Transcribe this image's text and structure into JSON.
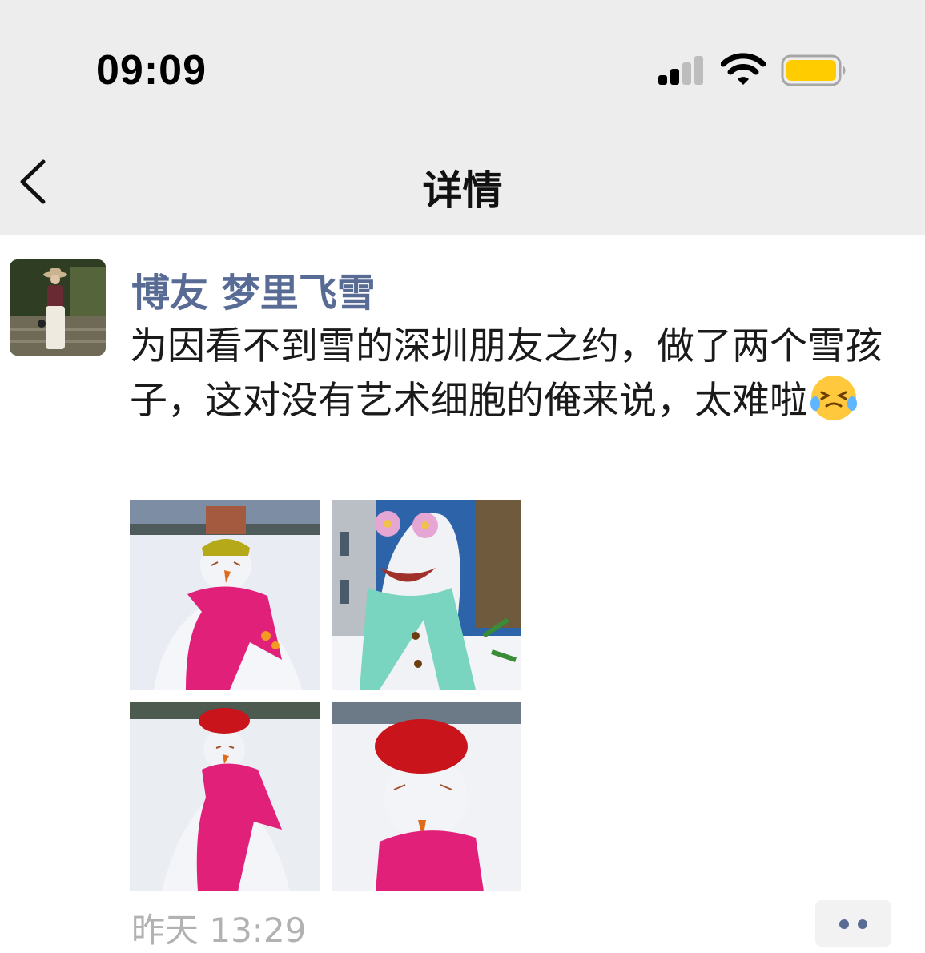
{
  "status_bar": {
    "time": "09:09"
  },
  "nav": {
    "title": "详情"
  },
  "post": {
    "author": "博友 梦里飞雪",
    "content": "为因看不到雪的深圳朋友之约，做了两个雪孩子，这对没有艺术细胞的俺来说，太难啦",
    "timestamp": "昨天 13:29"
  },
  "icons": {
    "back": "chevron-left-icon",
    "signal": "cellular-signal-icon",
    "wifi": "wifi-icon",
    "battery": "battery-icon",
    "emoji": "grinning-squint-tears-emoji",
    "more": "more-dots-icon"
  },
  "colors": {
    "nav_bg": "#ededed",
    "author": "#576b95",
    "timestamp": "#b2b2b2",
    "battery": "#ffcc00"
  }
}
